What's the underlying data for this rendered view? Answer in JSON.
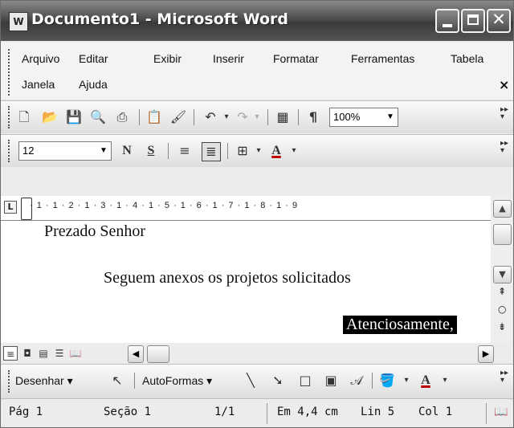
{
  "window": {
    "title": "Documento1 - Microsoft Word",
    "app_icon": "word-icon"
  },
  "menu": {
    "items": [
      "Arquivo",
      "Editar",
      "Exibir",
      "Inserir",
      "Formatar",
      "Ferramentas",
      "Tabela",
      "Janela",
      "Ajuda"
    ],
    "close_glyph": "×"
  },
  "standard_toolbar": {
    "icons": [
      "new-icon",
      "open-icon",
      "save-icon",
      "print-preview-icon",
      "print-icon",
      "paste-icon",
      "format-painter-icon",
      "undo-icon",
      "redo-icon",
      "table-icon",
      "show-formatting-icon"
    ],
    "zoom": "100%",
    "paragraph_mark": "¶"
  },
  "formatting_toolbar": {
    "font_size": "12",
    "bold": "N",
    "underline": "S",
    "font_color_letter": "A"
  },
  "ruler": {
    "marks": "· 1 · 1 · 2 · 1 · 3 · 1 · 4 · 1 · 5 · 1 · 6 · 1 · 7 · 1 · 8 · 1 · 9"
  },
  "document": {
    "lines": [
      "Prezado Senhor",
      "Seguem anexos os projetos solicitados",
      "Atenciosamente,"
    ]
  },
  "drawing_toolbar": {
    "draw": "Desenhar",
    "autoshapes": "AutoFormas",
    "font_color_letter": "A"
  },
  "status_bar": {
    "page": "Pág 1",
    "section": "Seção 1",
    "pages": "1/1",
    "position": "Em 4,4 cm",
    "line": "Lin 5",
    "column": "Col 1"
  },
  "colors": {
    "titlebar": "#4d4d4d",
    "selection": "#000000",
    "font_color_bar": "#c00000"
  }
}
